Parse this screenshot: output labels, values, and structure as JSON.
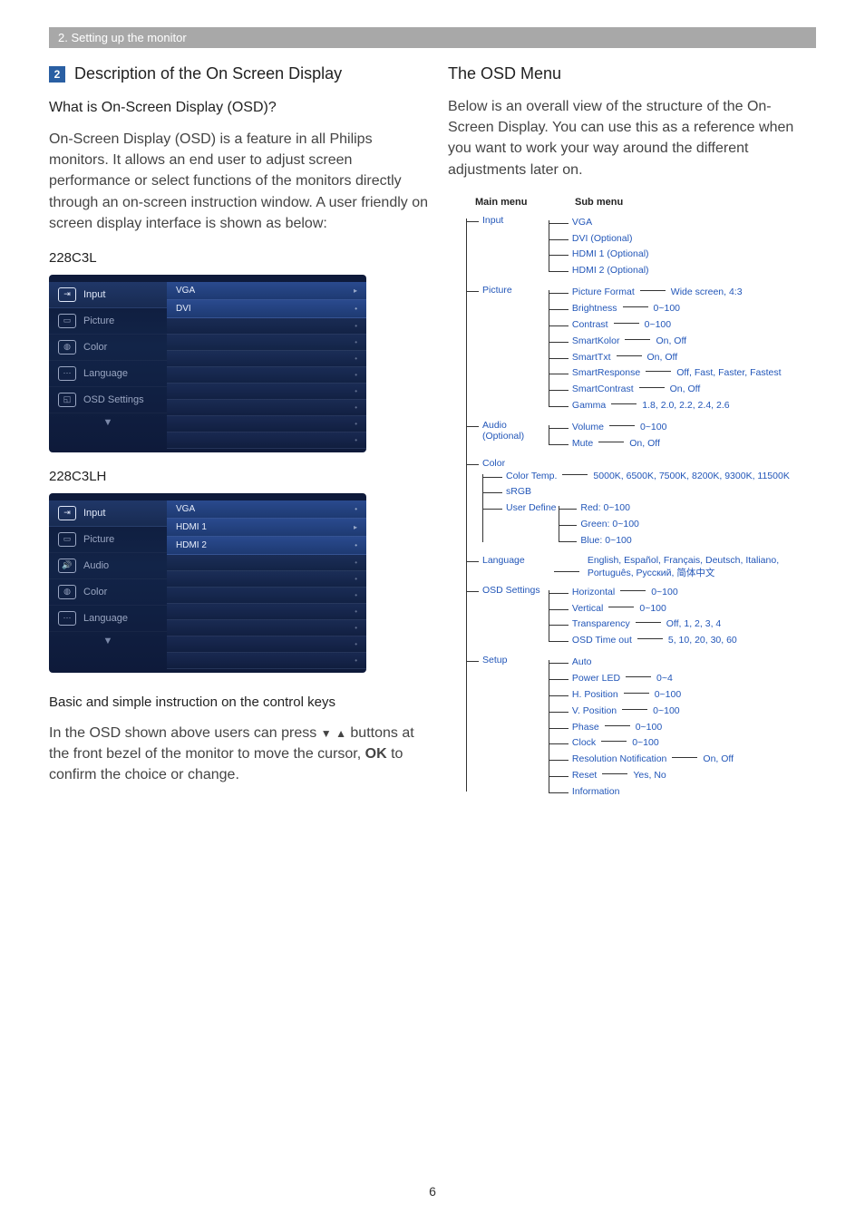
{
  "header_bar": "2. Setting up the monitor",
  "section_num": "2",
  "section_title": "Description of the On Screen Display",
  "q_what": "What is On-Screen Display (OSD)?",
  "p_what": "On-Screen Display (OSD) is a feature in all Philips monitors. It allows an end user to adjust screen performance or select functions of the monitors directly through an on-screen instruction window. A user friendly on screen display interface is shown as below:",
  "model_a": "228C3L",
  "model_b": "228C3LH",
  "osd_a": {
    "items": [
      "Input",
      "Picture",
      "Color",
      "Language",
      "OSD Settings"
    ],
    "right_hi": [
      "VGA",
      "DVI"
    ]
  },
  "osd_b": {
    "items": [
      "Input",
      "Picture",
      "Audio",
      "Color",
      "Language"
    ],
    "right_hi": [
      "VGA",
      "HDMI 1",
      "HDMI 2"
    ]
  },
  "instr_title": "Basic and simple instruction on the control keys",
  "instr_body_1": "In the OSD shown above users can press ",
  "instr_body_2": " buttons at the front bezel of the monitor to move the cursor, ",
  "instr_ok": "OK",
  "instr_body_3": " to confirm the choice or change.",
  "right_title": "The OSD Menu",
  "right_para": "Below is an overall view of the structure of the On-Screen Display. You can use this as a reference when you want to work your way around the different adjustments later on.",
  "tree_h1": "Main menu",
  "tree_h2": "Sub menu",
  "tree": {
    "input": {
      "label": "Input",
      "subs": [
        "VGA",
        "DVI (Optional)",
        "HDMI 1 (Optional)",
        "HDMI 2 (Optional)"
      ]
    },
    "picture": {
      "label": "Picture",
      "subs": [
        {
          "k": "Picture Format",
          "v": "Wide screen, 4:3"
        },
        {
          "k": "Brightness",
          "v": "0~100"
        },
        {
          "k": "Contrast",
          "v": "0~100"
        },
        {
          "k": "SmartKolor",
          "v": "On, Off"
        },
        {
          "k": "SmartTxt",
          "v": "On, Off"
        },
        {
          "k": "SmartResponse",
          "v": "Off, Fast, Faster, Fastest"
        },
        {
          "k": "SmartContrast",
          "v": "On, Off"
        },
        {
          "k": "Gamma",
          "v": "1.8, 2.0, 2.2, 2.4, 2.6"
        }
      ]
    },
    "audio": {
      "label": "Audio",
      "note": "(Optional)",
      "subs": [
        {
          "k": "Volume",
          "v": "0~100"
        },
        {
          "k": "Mute",
          "v": "On, Off"
        }
      ]
    },
    "color": {
      "label": "Color",
      "subs": [
        {
          "k": "Color Temp.",
          "v": "5000K, 6500K, 7500K, 8200K, 9300K, 11500K"
        },
        {
          "k": "sRGB"
        },
        {
          "k": "User Define",
          "nested": [
            "Red: 0~100",
            "Green: 0~100",
            "Blue: 0~100"
          ]
        }
      ]
    },
    "language": {
      "label": "Language",
      "val": "English, Español, Français, Deutsch, Italiano, Português, Русский, 简体中文"
    },
    "osd": {
      "label": "OSD Settings",
      "subs": [
        {
          "k": "Horizontal",
          "v": "0~100"
        },
        {
          "k": "Vertical",
          "v": "0~100"
        },
        {
          "k": "Transparency",
          "v": "Off, 1, 2, 3, 4"
        },
        {
          "k": "OSD Time out",
          "v": "5, 10, 20, 30, 60"
        }
      ]
    },
    "setup": {
      "label": "Setup",
      "subs": [
        {
          "k": "Auto"
        },
        {
          "k": "Power LED",
          "v": "0~4"
        },
        {
          "k": "H. Position",
          "v": "0~100"
        },
        {
          "k": "V. Position",
          "v": "0~100"
        },
        {
          "k": "Phase",
          "v": "0~100"
        },
        {
          "k": "Clock",
          "v": "0~100"
        },
        {
          "k": "Resolution Notification",
          "v": "On, Off"
        },
        {
          "k": "Reset",
          "v": "Yes, No"
        },
        {
          "k": "Information"
        }
      ]
    }
  },
  "page_num": "6"
}
